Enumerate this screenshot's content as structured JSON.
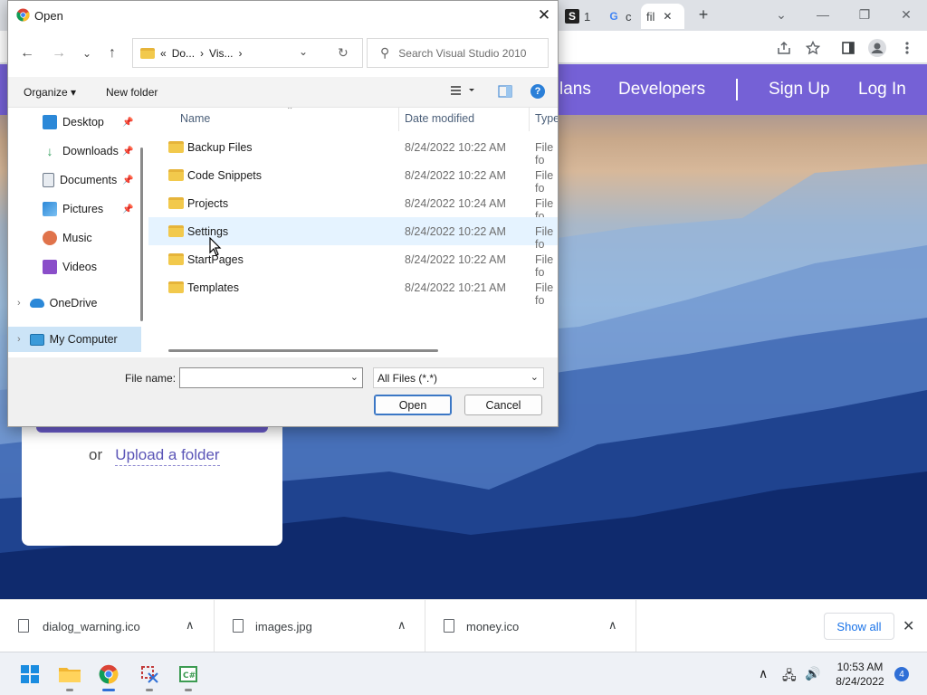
{
  "browser": {
    "tabs": [
      {
        "favicon_text": "S",
        "label": "1"
      },
      {
        "favicon_text": "G",
        "label": "c"
      },
      {
        "favicon_text": "",
        "label": "fil"
      }
    ],
    "tab_close": "✕",
    "new_tab": "+",
    "window_controls": {
      "dropdown": "⌄",
      "minimize": "—",
      "restore": "❐",
      "close": "✕"
    },
    "toolbar_icons": [
      "share-icon",
      "star-icon",
      "sidepanel-icon",
      "profile-icon",
      "menu-icon"
    ]
  },
  "webpage": {
    "nav": {
      "plans": "lans",
      "developers": "Developers",
      "signup": "Sign Up",
      "login": "Log In"
    },
    "upload": {
      "or": "or",
      "folder_link": "Upload a folder"
    },
    "colors": {
      "nav": "#7561d6"
    }
  },
  "dialog": {
    "title": "Open",
    "close": "✕",
    "nav": {
      "back": "←",
      "forward": "→",
      "recent": "⌄",
      "up": "↑"
    },
    "address": {
      "chevrons": "«",
      "crumbs": [
        "Do...",
        "Vis..."
      ],
      "sep": "›",
      "dropdown": "⌄",
      "refresh": "↻"
    },
    "search": {
      "placeholder": "Search Visual Studio 2010",
      "icon": "⚲"
    },
    "commands": {
      "organize": "Organize ▾",
      "new_folder": "New folder",
      "help": "?"
    },
    "nav_pane": [
      {
        "label": "Desktop",
        "icon": "desktop-icon",
        "color": "#2b88d8",
        "pinned": true
      },
      {
        "label": "Downloads",
        "icon": "download-icon",
        "color": "#2d9d58",
        "pinned": true
      },
      {
        "label": "Documents",
        "icon": "documents-icon",
        "color": "#6e7a8a",
        "pinned": true
      },
      {
        "label": "Pictures",
        "icon": "pictures-icon",
        "color": "#2b88d8",
        "pinned": true
      },
      {
        "label": "Music",
        "icon": "music-icon",
        "color": "#e0734b",
        "pinned": false
      },
      {
        "label": "Videos",
        "icon": "videos-icon",
        "color": "#8a4ec9",
        "pinned": false
      },
      {
        "label": "OneDrive",
        "icon": "onedrive-icon",
        "color": "#2b88d8",
        "pinned": false
      },
      {
        "label": "My Computer",
        "icon": "computer-icon",
        "color": "#3a9ad9",
        "pinned": false
      }
    ],
    "columns": {
      "name": "Name",
      "date": "Date modified",
      "type": "Type"
    },
    "files": [
      {
        "name": "Backup Files",
        "date": "8/24/2022 10:22 AM",
        "type": "File fo"
      },
      {
        "name": "Code Snippets",
        "date": "8/24/2022 10:22 AM",
        "type": "File fo"
      },
      {
        "name": "Projects",
        "date": "8/24/2022 10:24 AM",
        "type": "File fo"
      },
      {
        "name": "Settings",
        "date": "8/24/2022 10:22 AM",
        "type": "File fo"
      },
      {
        "name": "StartPages",
        "date": "8/24/2022 10:22 AM",
        "type": "File fo"
      },
      {
        "name": "Templates",
        "date": "8/24/2022 10:21 AM",
        "type": "File fo"
      }
    ],
    "file_name_label": "File name:",
    "file_name_value": "",
    "file_type": "All Files (*.*)",
    "open_btn": "Open",
    "cancel_btn": "Cancel"
  },
  "downloads": {
    "items": [
      {
        "name": "dialog_warning.ico"
      },
      {
        "name": "images.jpg"
      },
      {
        "name": "money.ico"
      }
    ],
    "show_all": "Show all",
    "close": "✕",
    "caret": "∧"
  },
  "taskbar": {
    "time": "10:53 AM",
    "date": "8/24/2022",
    "notifications": "4",
    "tray": {
      "chevron": "∧",
      "network": "🖧",
      "volume": "🔊"
    }
  }
}
